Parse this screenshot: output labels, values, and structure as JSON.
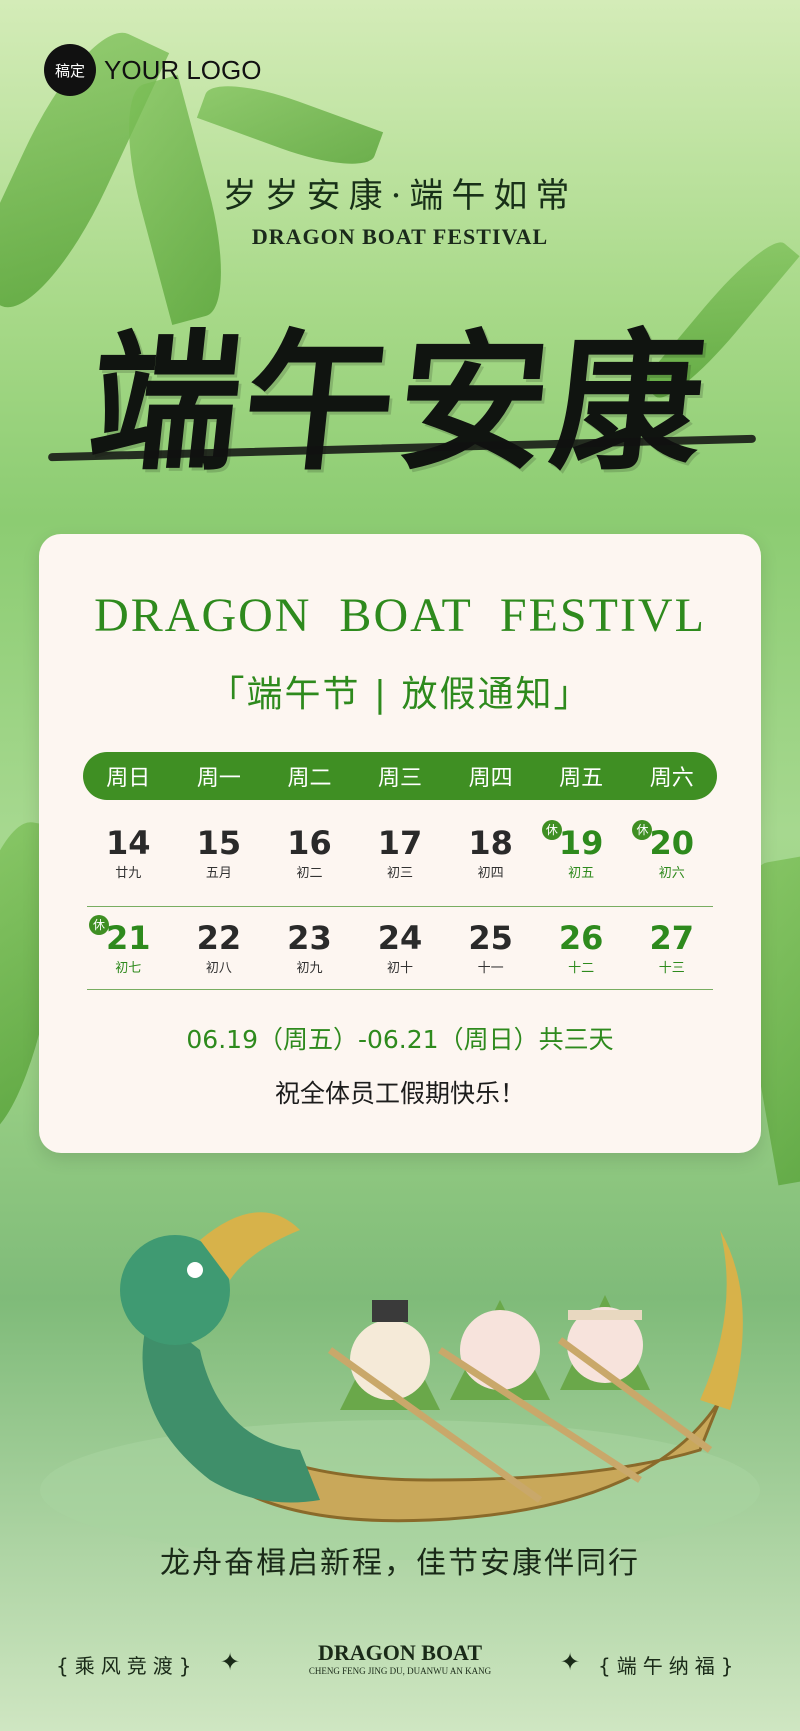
{
  "logo": {
    "badge": "稿定",
    "text": "YOUR LOGO"
  },
  "header": {
    "slogan": "岁岁安康·端午如常",
    "subtitle_en": "DRAGON BOAT FESTIVAL",
    "big_title": "端午安康"
  },
  "card": {
    "title_en": "DRAGON BOAT FESTIVL",
    "title_cn": "「端午节 | 放假通知」",
    "weekdays": [
      "周日",
      "周一",
      "周二",
      "周三",
      "周四",
      "周五",
      "周六"
    ],
    "holiday_mark": "休",
    "row1": [
      {
        "day": "14",
        "lunar": "廿九"
      },
      {
        "day": "15",
        "lunar": "五月"
      },
      {
        "day": "16",
        "lunar": "初二"
      },
      {
        "day": "17",
        "lunar": "初三"
      },
      {
        "day": "18",
        "lunar": "初四"
      },
      {
        "day": "19",
        "lunar": "初五"
      },
      {
        "day": "20",
        "lunar": "初六"
      }
    ],
    "row2": [
      {
        "day": "21",
        "lunar": "初七"
      },
      {
        "day": "22",
        "lunar": "初八"
      },
      {
        "day": "23",
        "lunar": "初九"
      },
      {
        "day": "24",
        "lunar": "初十"
      },
      {
        "day": "25",
        "lunar": "十一"
      },
      {
        "day": "26",
        "lunar": "十二"
      },
      {
        "day": "27",
        "lunar": "十三"
      }
    ],
    "range": "06.19（周五）-06.21（周日）共三天",
    "wish": "祝全体员工假期快乐！"
  },
  "tagline": "龙舟奋楫启新程，佳节安康伴同行",
  "footer": {
    "left": "{乘风竞渡}",
    "right": "{端午纳福}",
    "center_title": "DRAGON BOAT",
    "center_sub": "CHENG FENG JING DU, DUANWU AN KANG"
  },
  "colors": {
    "accent": "#3f8f23",
    "card_bg": "#fdf6f1"
  }
}
